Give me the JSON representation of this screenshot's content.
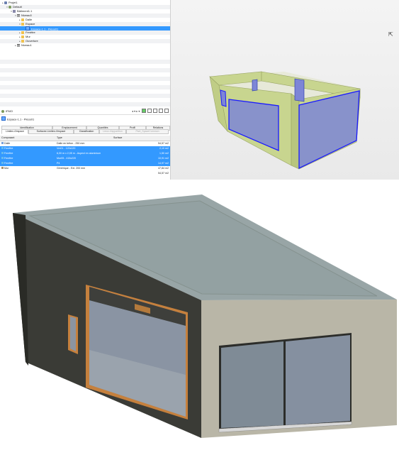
{
  "tree": [
    {
      "label": "Projet1",
      "icon": "project-icon",
      "toggle": "▸",
      "depth": 0
    },
    {
      "label": "Default",
      "icon": "site-icon",
      "toggle": "▾",
      "depth": 1
    },
    {
      "label": "Bâtiment1.1",
      "icon": "building-icon",
      "toggle": "▾",
      "depth": 2
    },
    {
      "label": "Niveau0",
      "icon": "level-icon",
      "toggle": "▾",
      "depth": 3
    },
    {
      "label": "Dalle",
      "icon": "folder-icon",
      "toggle": "▸",
      "depth": 4
    },
    {
      "label": "Espace",
      "icon": "folder-icon",
      "toggle": "▾",
      "depth": 4
    },
    {
      "label": "Espace-1.1 - Pièce01",
      "icon": "space-icon",
      "toggle": "",
      "depth": 5,
      "selected": true
    },
    {
      "label": "Fenêtre",
      "icon": "folder-icon",
      "toggle": "▸",
      "depth": 4
    },
    {
      "label": "Mur",
      "icon": "folder-icon",
      "toggle": "▸",
      "depth": 4
    },
    {
      "label": "Ouverture",
      "icon": "folder-icon",
      "toggle": "▸",
      "depth": 4
    },
    {
      "label": "Niveau1",
      "icon": "level-icon",
      "toggle": "▸",
      "depth": 3
    }
  ],
  "props": {
    "title": "IFMO",
    "toolbar": "◂  ▾  ▸  ▾",
    "element": "Espace-1.1 - Pièce01",
    "tabs_row1": [
      {
        "label": "Identification",
        "active": false,
        "disabled": false
      },
      {
        "label": "Emplacement",
        "active": false,
        "disabled": false
      },
      {
        "label": "Quantités",
        "active": false,
        "disabled": false
      },
      {
        "label": "Profil",
        "active": false,
        "disabled": false
      },
      {
        "label": "Relations",
        "active": false,
        "disabled": false
      }
    ],
    "tabs_row2": [
      {
        "label": "Limites d'espace",
        "active": true,
        "disabled": false
      },
      {
        "label": "Surfaces Limites d'espace",
        "active": false,
        "disabled": false
      },
      {
        "label": "Classification",
        "active": false,
        "disabled": false
      },
      {
        "label": "Lieux d'apparition",
        "active": false,
        "disabled": true
      },
      {
        "label": "Pset_SpaceCommon",
        "active": false,
        "disabled": true
      }
    ],
    "columns": [
      "Composant",
      "Type",
      "Surface"
    ],
    "rows": [
      {
        "component": "Dalle",
        "type": "Dalle en béton - 250 mm",
        "surface": "54,57 m2",
        "icon": "slab",
        "selected": false
      },
      {
        "component": "Fenêtre",
        "type": "Vm01 - 120x120",
        "surface": "2,10 m2",
        "icon": "window",
        "selected": true
      },
      {
        "component": "Fenêtre",
        "type": "6,00 m x 2,05 m - Aspect en aluminium",
        "surface": "1,50 m2",
        "icon": "window",
        "selected": true
      },
      {
        "component": "Fenêtre",
        "type": "Mur05 - 415x220",
        "surface": "10,91 m2",
        "icon": "window",
        "selected": true
      },
      {
        "component": "Fenêtre",
        "type": "P4",
        "surface": "14,97 m2",
        "icon": "window",
        "selected": true
      },
      {
        "component": "Mur",
        "type": "Générique - Ext. 200 mm",
        "surface": "47,84 m2",
        "icon": "wall",
        "selected": false
      },
      {
        "component": "",
        "type": "",
        "surface": "54,57 m2",
        "icon": "",
        "selected": false
      }
    ]
  },
  "colors": {
    "selection": "#3399ff",
    "space_fill": "#7d86d6",
    "space_edge": "#1a1aff",
    "wall_fill": "#c8d58f",
    "roof": "#98a5a6",
    "facade_dark": "#3a3b36",
    "facade_light": "#b9b6a7"
  }
}
